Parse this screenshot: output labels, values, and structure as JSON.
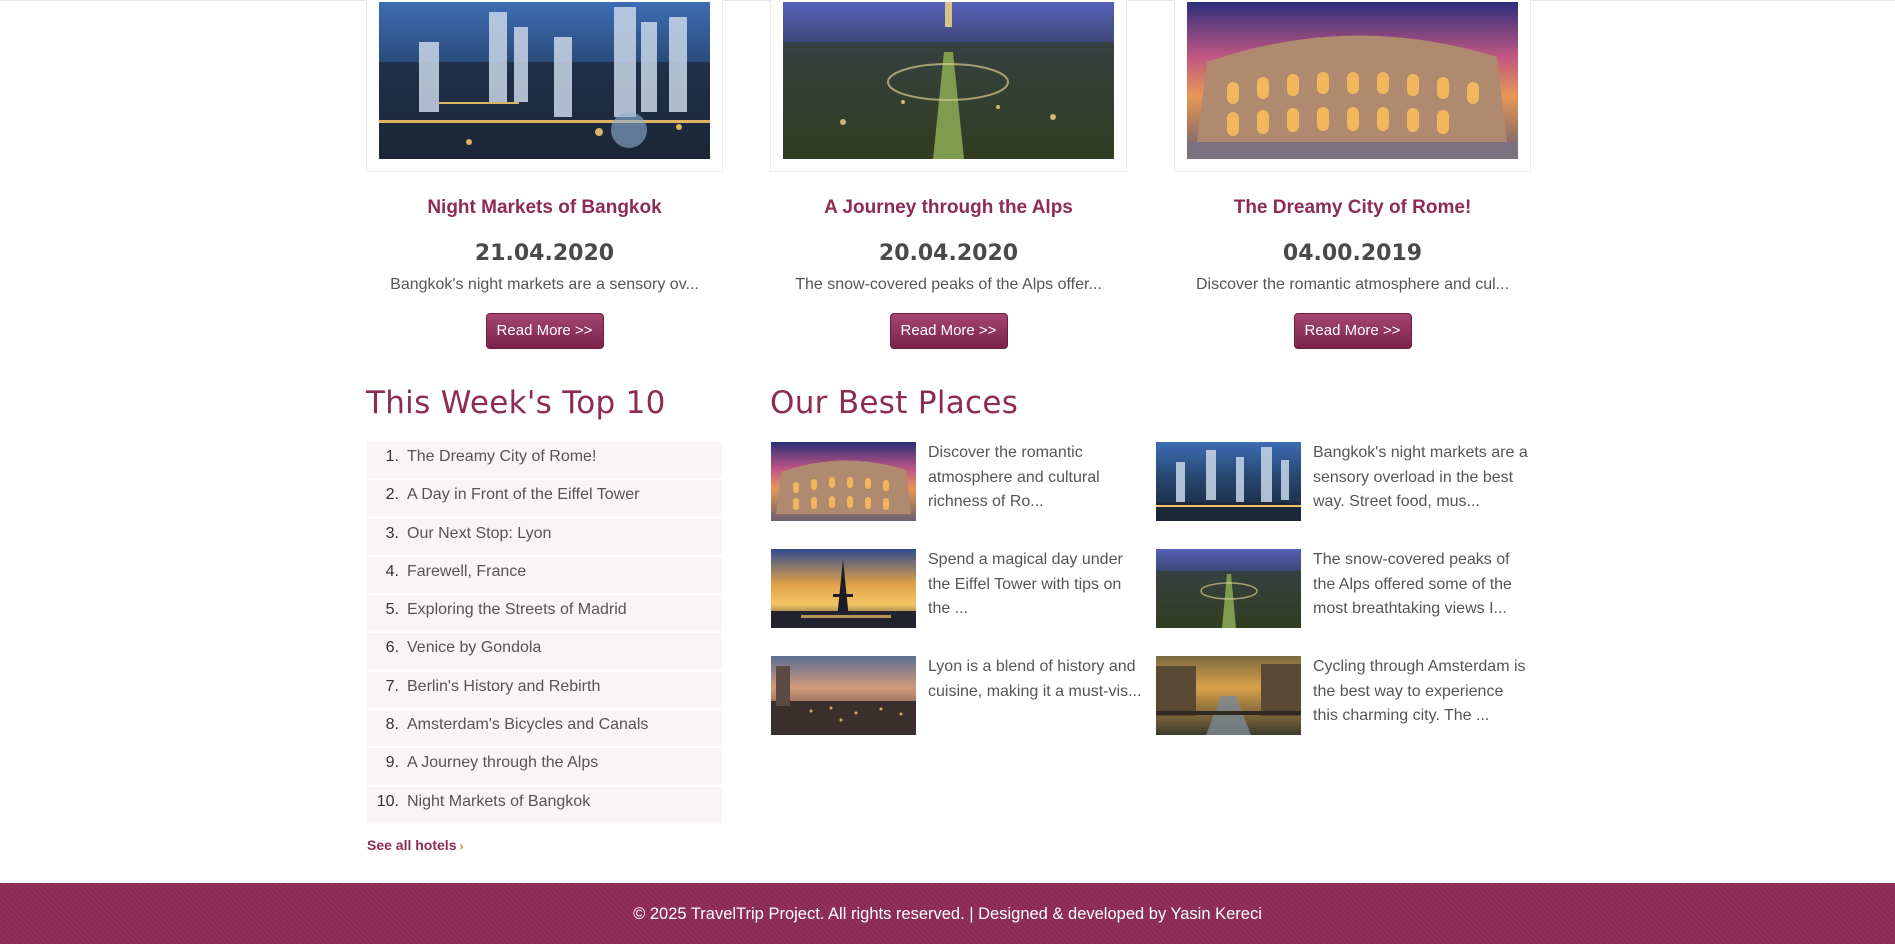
{
  "colors": {
    "accent": "#8e2b55",
    "footer_bg": "#8e2b55",
    "button_bg": "#8f3560"
  },
  "cards": [
    {
      "title": "Night Markets of Bangkok",
      "date": "21.04.2020",
      "excerpt": "Bangkok's night markets are a sensory ov...",
      "button": "Read More >>",
      "image": "bangkok-city-night-photo"
    },
    {
      "title": "A Journey through the Alps",
      "date": "20.04.2020",
      "excerpt": "The snow-covered peaks of the Alps offer...",
      "button": "Read More >>",
      "image": "paris-champ-de-mars-dusk-photo"
    },
    {
      "title": "The Dreamy City of Rome!",
      "date": "04.00.2019",
      "excerpt": "Discover the romantic atmosphere and cul...",
      "button": "Read More >>",
      "image": "rome-colosseum-sunset-photo"
    }
  ],
  "top10": {
    "heading": "This Week's Top 10",
    "items": [
      {
        "num": "1.",
        "label": "The Dreamy City of Rome!"
      },
      {
        "num": "2.",
        "label": "A Day in Front of the Eiffel Tower"
      },
      {
        "num": "3.",
        "label": "Our Next Stop: Lyon"
      },
      {
        "num": "4.",
        "label": "Farewell, France"
      },
      {
        "num": "5.",
        "label": "Exploring the Streets of Madrid"
      },
      {
        "num": "6.",
        "label": "Venice by Gondola"
      },
      {
        "num": "7.",
        "label": "Berlin's History and Rebirth"
      },
      {
        "num": "8.",
        "label": "Amsterdam's Bicycles and Canals"
      },
      {
        "num": "9.",
        "label": "A Journey through the Alps"
      },
      {
        "num": "10.",
        "label": "Night Markets of Bangkok"
      }
    ],
    "see_all": "See all hotels",
    "see_all_chevron": "›"
  },
  "best_places": {
    "heading": "Our Best Places",
    "items": [
      {
        "text": "Discover the romantic atmosphere and cultural richness of Ro...",
        "image": "rome-colosseum-photo"
      },
      {
        "text": "Bangkok's night markets are a sensory overload in the best way. Street food, mus...",
        "image": "bangkok-city-photo"
      },
      {
        "text": "Spend a magical day under the Eiffel Tower with tips on the ...",
        "image": "eiffel-tower-sunset-photo"
      },
      {
        "text": "The snow-covered peaks of the Alps offered some of the most breathtaking views I...",
        "image": "paris-park-dusk-photo"
      },
      {
        "text": "Lyon is a blend of history and cuisine, making it a must-vis...",
        "image": "lyon-city-dusk-photo"
      },
      {
        "text": "Cycling through Amsterdam is the best way to experience this charming city. The ...",
        "image": "amsterdam-canal-photo"
      }
    ]
  },
  "footer": {
    "text": "© 2025 TravelTrip Project. All rights reserved. | Designed & developed by Yasin Kereci"
  }
}
